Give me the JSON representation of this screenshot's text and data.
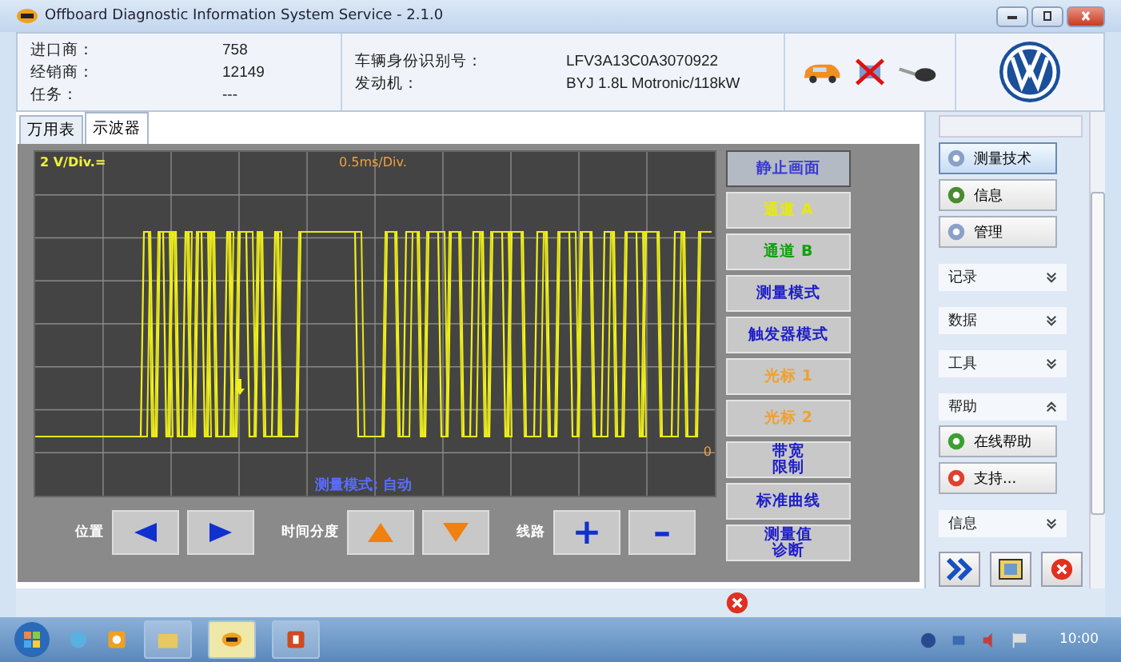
{
  "window": {
    "title": "Offboard Diagnostic Information System Service - 2.1.0"
  },
  "left_fields": [
    {
      "label": "进口商：",
      "value": "758"
    },
    {
      "label": "经销商：",
      "value": "12149"
    },
    {
      "label": "任务：",
      "value": "---"
    }
  ],
  "right_fields": [
    {
      "label": "车辆身份识别号：",
      "value": "LFV3A13C0A3070922"
    },
    {
      "label": "发动机：",
      "value": "BYJ 1.8L Motronic/118kW"
    }
  ],
  "tabs": [
    {
      "label": "万用表",
      "selected": false
    },
    {
      "label": "示波器",
      "selected": true
    }
  ],
  "scope": {
    "volts_per_div": "2 V/Div.=",
    "time_per_div": "0.5ms/Div.",
    "zero_marker": "0",
    "mode_text": "测量模式: 自动"
  },
  "side_buttons": [
    {
      "label": "静止画面",
      "color": "#3a3ad0",
      "selected": true
    },
    {
      "label": "通道 A",
      "color": "#e8e810",
      "selected": false
    },
    {
      "label": "通道 B",
      "color": "#10a010",
      "selected": false
    },
    {
      "label": "测量模式",
      "color": "#2020c8",
      "selected": false
    },
    {
      "label": "触发器模式",
      "color": "#2020c8",
      "selected": false
    },
    {
      "label": "光标 1",
      "color": "#f0a030",
      "selected": false
    },
    {
      "label": "光标 2",
      "color": "#f0a030",
      "selected": false
    },
    {
      "label": "带宽限制",
      "kind": "two-line",
      "color": "#2020c8",
      "selected": false
    },
    {
      "label": "标准曲线",
      "color": "#2020c8",
      "selected": false
    },
    {
      "label": "测量值诊断",
      "kind": "two-line",
      "color": "#2020c8",
      "selected": false
    }
  ],
  "controls": [
    {
      "label": "位置",
      "buttons": [
        {
          "kind": "left"
        },
        {
          "kind": "right"
        }
      ]
    },
    {
      "label": "时间分度",
      "buttons": [
        {
          "kind": "up"
        },
        {
          "kind": "down"
        }
      ]
    },
    {
      "label": "线路",
      "buttons": [
        {
          "kind": "text",
          "text": "+"
        },
        {
          "kind": "text",
          "text": "–"
        }
      ]
    }
  ],
  "sidebar": {
    "items": [
      {
        "kind": "button",
        "label": "测量技术",
        "selected": true
      },
      {
        "kind": "button",
        "label": "信息",
        "selected": false
      },
      {
        "kind": "button",
        "label": "管理",
        "selected": false
      },
      {
        "kind": "section",
        "label": "记录",
        "expanded": false
      },
      {
        "kind": "section",
        "label": "数据",
        "expanded": false
      },
      {
        "kind": "section",
        "label": "工具",
        "expanded": false
      },
      {
        "kind": "section",
        "label": "帮助",
        "expanded": true
      },
      {
        "kind": "button",
        "label": "在线帮助",
        "selected": false
      },
      {
        "kind": "button",
        "label": "支持...",
        "selected": false
      },
      {
        "kind": "section",
        "label": "信息",
        "expanded": false
      }
    ]
  },
  "taskbar": {
    "clock": "10:00"
  }
}
